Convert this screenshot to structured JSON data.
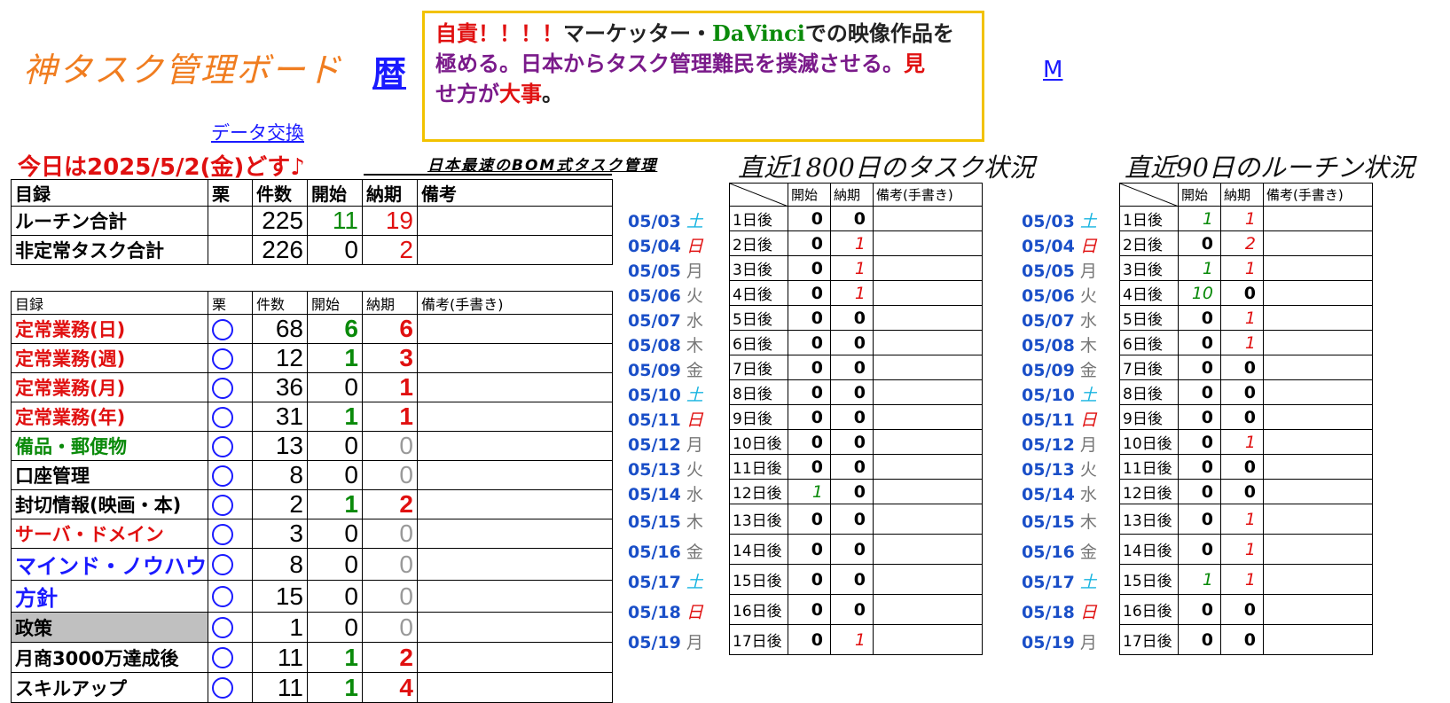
{
  "header": {
    "board_title": "神タスク管理ボード",
    "koyomi_link": "暦",
    "motto": {
      "part1": "自責！！！！",
      "part2": "マーケッター・",
      "part3": "DaVinci",
      "part4": "での映像作品を",
      "part5": "極める。日本からタスク管理難民を撲滅させる。",
      "part6": "見",
      "part7": "せ方が",
      "part8": "大事",
      "part9": "。"
    },
    "m_link": "M",
    "data_link": "データ交換",
    "today": "今日は2025/5/2(金)どす♪",
    "bom": "日本最速のBOM式タスク管理"
  },
  "summary": {
    "headers": [
      "目録",
      "栗",
      "件数",
      "開始",
      "納期",
      "備考"
    ],
    "rows": [
      {
        "name": "ルーチン合計",
        "count": "225",
        "start": "11",
        "due": "19"
      },
      {
        "name": "非定常タスク合計",
        "count": "226",
        "start": "0",
        "due": "2"
      }
    ]
  },
  "catalog": {
    "headers": [
      "目録",
      "栗",
      "件数",
      "開始",
      "納期",
      "備考(手書き)"
    ],
    "rows": [
      {
        "name": "定常業務(日)",
        "count": "68",
        "start": "6",
        "due": "6"
      },
      {
        "name": "定常業務(週)",
        "count": "12",
        "start": "1",
        "due": "3"
      },
      {
        "name": "定常業務(月)",
        "count": "36",
        "start": "0",
        "due": "1"
      },
      {
        "name": "定常業務(年)",
        "count": "31",
        "start": "1",
        "due": "1"
      },
      {
        "name": "備品・郵便物",
        "count": "13",
        "start": "0",
        "due": "0"
      },
      {
        "name": "口座管理",
        "count": "8",
        "start": "0",
        "due": "0"
      },
      {
        "name": "封切情報(映画・本)",
        "count": "2",
        "start": "1",
        "due": "2"
      },
      {
        "name": "サーバ・ドメイン",
        "count": "3",
        "start": "0",
        "due": "0"
      },
      {
        "name": "マインド・ノウハウ",
        "count": "8",
        "start": "0",
        "due": "0"
      },
      {
        "name": "方針",
        "count": "15",
        "start": "0",
        "due": "0"
      },
      {
        "name": "政策",
        "count": "1",
        "start": "0",
        "due": "0"
      },
      {
        "name": "月商3000万達成後",
        "count": "11",
        "start": "1",
        "due": "2"
      },
      {
        "name": "スキルアップ",
        "count": "11",
        "start": "1",
        "due": "4"
      }
    ]
  },
  "task1800": {
    "title": "直近1800日のタスク状況",
    "headers": [
      "開始",
      "納期",
      "備考(手書き)"
    ],
    "rows": [
      {
        "date": "05/03",
        "dow": "土",
        "after": "1日後",
        "start": "0",
        "due": "0"
      },
      {
        "date": "05/04",
        "dow": "日",
        "after": "2日後",
        "start": "0",
        "due": "1"
      },
      {
        "date": "05/05",
        "dow": "月",
        "after": "3日後",
        "start": "0",
        "due": "1"
      },
      {
        "date": "05/06",
        "dow": "火",
        "after": "4日後",
        "start": "0",
        "due": "1"
      },
      {
        "date": "05/07",
        "dow": "水",
        "after": "5日後",
        "start": "0",
        "due": "0"
      },
      {
        "date": "05/08",
        "dow": "木",
        "after": "6日後",
        "start": "0",
        "due": "0"
      },
      {
        "date": "05/09",
        "dow": "金",
        "after": "7日後",
        "start": "0",
        "due": "0"
      },
      {
        "date": "05/10",
        "dow": "土",
        "after": "8日後",
        "start": "0",
        "due": "0"
      },
      {
        "date": "05/11",
        "dow": "日",
        "after": "9日後",
        "start": "0",
        "due": "0"
      },
      {
        "date": "05/12",
        "dow": "月",
        "after": "10日後",
        "start": "0",
        "due": "0"
      },
      {
        "date": "05/13",
        "dow": "火",
        "after": "11日後",
        "start": "0",
        "due": "0"
      },
      {
        "date": "05/14",
        "dow": "水",
        "after": "12日後",
        "start": "1",
        "due": "0"
      },
      {
        "date": "05/15",
        "dow": "木",
        "after": "13日後",
        "start": "0",
        "due": "0"
      },
      {
        "date": "05/16",
        "dow": "金",
        "after": "14日後",
        "start": "0",
        "due": "0"
      },
      {
        "date": "05/17",
        "dow": "土",
        "after": "15日後",
        "start": "0",
        "due": "0"
      },
      {
        "date": "05/18",
        "dow": "日",
        "after": "16日後",
        "start": "0",
        "due": "0"
      },
      {
        "date": "05/19",
        "dow": "月",
        "after": "17日後",
        "start": "0",
        "due": "1"
      }
    ]
  },
  "routine90": {
    "title": "直近90日のルーチン状況",
    "headers": [
      "開始",
      "納期",
      "備考(手書き)"
    ],
    "rows": [
      {
        "date": "05/03",
        "dow": "土",
        "after": "1日後",
        "start": "1",
        "due": "1"
      },
      {
        "date": "05/04",
        "dow": "日",
        "after": "2日後",
        "start": "0",
        "due": "2"
      },
      {
        "date": "05/05",
        "dow": "月",
        "after": "3日後",
        "start": "1",
        "due": "1"
      },
      {
        "date": "05/06",
        "dow": "火",
        "after": "4日後",
        "start": "10",
        "due": "0"
      },
      {
        "date": "05/07",
        "dow": "水",
        "after": "5日後",
        "start": "0",
        "due": "1"
      },
      {
        "date": "05/08",
        "dow": "木",
        "after": "6日後",
        "start": "0",
        "due": "1"
      },
      {
        "date": "05/09",
        "dow": "金",
        "after": "7日後",
        "start": "0",
        "due": "0"
      },
      {
        "date": "05/10",
        "dow": "土",
        "after": "8日後",
        "start": "0",
        "due": "0"
      },
      {
        "date": "05/11",
        "dow": "日",
        "after": "9日後",
        "start": "0",
        "due": "0"
      },
      {
        "date": "05/12",
        "dow": "月",
        "after": "10日後",
        "start": "0",
        "due": "1"
      },
      {
        "date": "05/13",
        "dow": "火",
        "after": "11日後",
        "start": "0",
        "due": "0"
      },
      {
        "date": "05/14",
        "dow": "水",
        "after": "12日後",
        "start": "0",
        "due": "0"
      },
      {
        "date": "05/15",
        "dow": "木",
        "after": "13日後",
        "start": "0",
        "due": "1"
      },
      {
        "date": "05/16",
        "dow": "金",
        "after": "14日後",
        "start": "0",
        "due": "1"
      },
      {
        "date": "05/17",
        "dow": "土",
        "after": "15日後",
        "start": "1",
        "due": "1"
      },
      {
        "date": "05/18",
        "dow": "日",
        "after": "16日後",
        "start": "0",
        "due": "0"
      },
      {
        "date": "05/19",
        "dow": "月",
        "after": "17日後",
        "start": "0",
        "due": "0"
      }
    ]
  }
}
